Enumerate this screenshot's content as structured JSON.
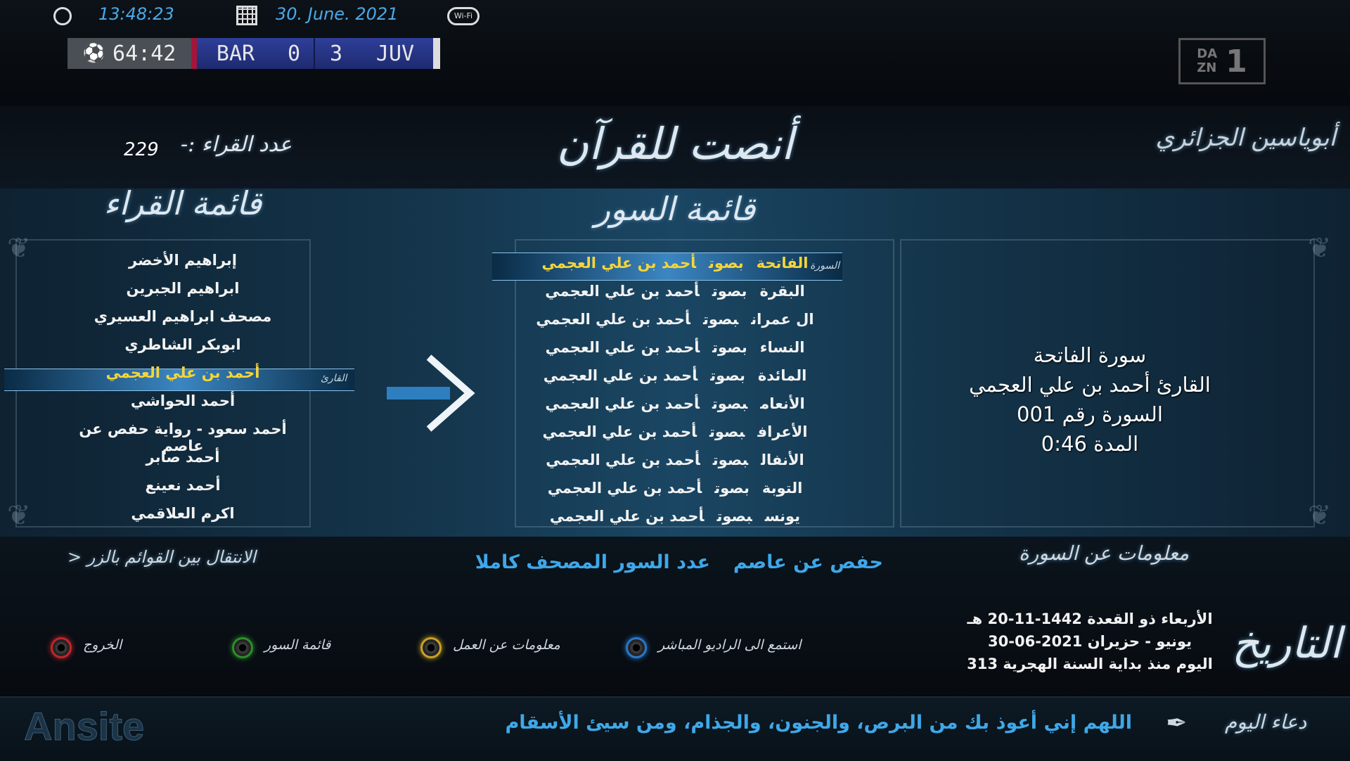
{
  "status_bar": {
    "time": "13:48:23",
    "date": "30. June. 2021",
    "wifi_label": "Wi-Fi"
  },
  "scoreboard": {
    "match_clock": "64:42",
    "home_team": "BAR",
    "home_score": "0",
    "away_score": "3",
    "away_team": "JUV",
    "channel_top": "DA\nZN",
    "channel_number": "1"
  },
  "header": {
    "author": "أبوياسين الجزائري",
    "app_title": "أنصت للقرآن",
    "reciter_count_label": "عدد القراء :-",
    "reciter_count": "229"
  },
  "reciters": {
    "title": "قائمة القراء",
    "selected_tag": "القارئ",
    "items": [
      "إبراهيم الأخضر",
      "ابراهيم الجبرين",
      "مصحف ابراهيم العسيري",
      "ابوبكر الشاطري",
      "أحمد بن علي العجمي",
      "أحمد الحواشي",
      "أحمد سعود - رواية حفص عن عاصم",
      "أحمد صابر",
      "أحمد نعينع",
      "اكرم العلاقمي"
    ],
    "selected_index": 4
  },
  "surahs": {
    "title": "قائمة السور",
    "selected_tag": "السورة",
    "items": [
      {
        "name": "الفاتحة",
        "by": "بصوت",
        "reciter": "أحمد بن علي العجمي"
      },
      {
        "name": "البقرة",
        "by": "بصوت",
        "reciter": "أحمد بن علي العجمي"
      },
      {
        "name": "ال عمران",
        "by": "بصوت",
        "reciter": "أحمد بن علي العجمي"
      },
      {
        "name": "النساء",
        "by": "بصوت",
        "reciter": "أحمد بن علي العجمي"
      },
      {
        "name": "المائدة",
        "by": "بصوت",
        "reciter": "أحمد بن علي العجمي"
      },
      {
        "name": "الأنعام",
        "by": "بصوت",
        "reciter": "أحمد بن علي العجمي"
      },
      {
        "name": "الأعراف",
        "by": "بصوت",
        "reciter": "أحمد بن علي العجمي"
      },
      {
        "name": "الأنفال",
        "by": "بصوت",
        "reciter": "أحمد بن علي العجمي"
      },
      {
        "name": "التوبة",
        "by": "بصوت",
        "reciter": "أحمد بن علي العجمي"
      },
      {
        "name": "يونس",
        "by": "بصوت",
        "reciter": "أحمد بن علي العجمي"
      }
    ],
    "selected_index": 0
  },
  "info_panel": {
    "line1": "سورة الفاتحة",
    "line2": "القارئ أحمد بن علي العجمي",
    "line3": "السورة رقم 001",
    "line4": "المدة 0:46",
    "title": "معلومات عن السورة"
  },
  "footer": {
    "nav_hint": "الانتقال بين القوائم بالزر <",
    "riwaya": "حفص عن عاصم",
    "full_mushaf": "عدد السور المصحف كاملا"
  },
  "buttons": [
    {
      "label": "الخروج",
      "color": "#c0262b"
    },
    {
      "label": "قائمة السور",
      "color": "#2c8f2a"
    },
    {
      "label": "معلومات عن العمل",
      "color": "#c9a227"
    },
    {
      "label": "استمع الى الراديو المباشر",
      "color": "#2a78c9"
    }
  ],
  "date_panel": {
    "title": "التاريخ",
    "hijri": "الأربعاء ذو القعدة 1442-11-20 هـ",
    "gregorian": "يونيو - حزيران 2021-06-30",
    "day_of_year": "اليوم منذ بداية السنة الهجرية  313"
  },
  "dua": {
    "label": "دعاء اليوم",
    "text": "اللهم إني أعوذ بك من البرص، والجنون، والجذام، ومن سيئ الأسقام"
  },
  "brand": "Ansite",
  "colors": {
    "accent_blue": "#4aa9e8",
    "highlight_yellow": "#f5d53a",
    "link_blue": "#3fa7e8"
  }
}
